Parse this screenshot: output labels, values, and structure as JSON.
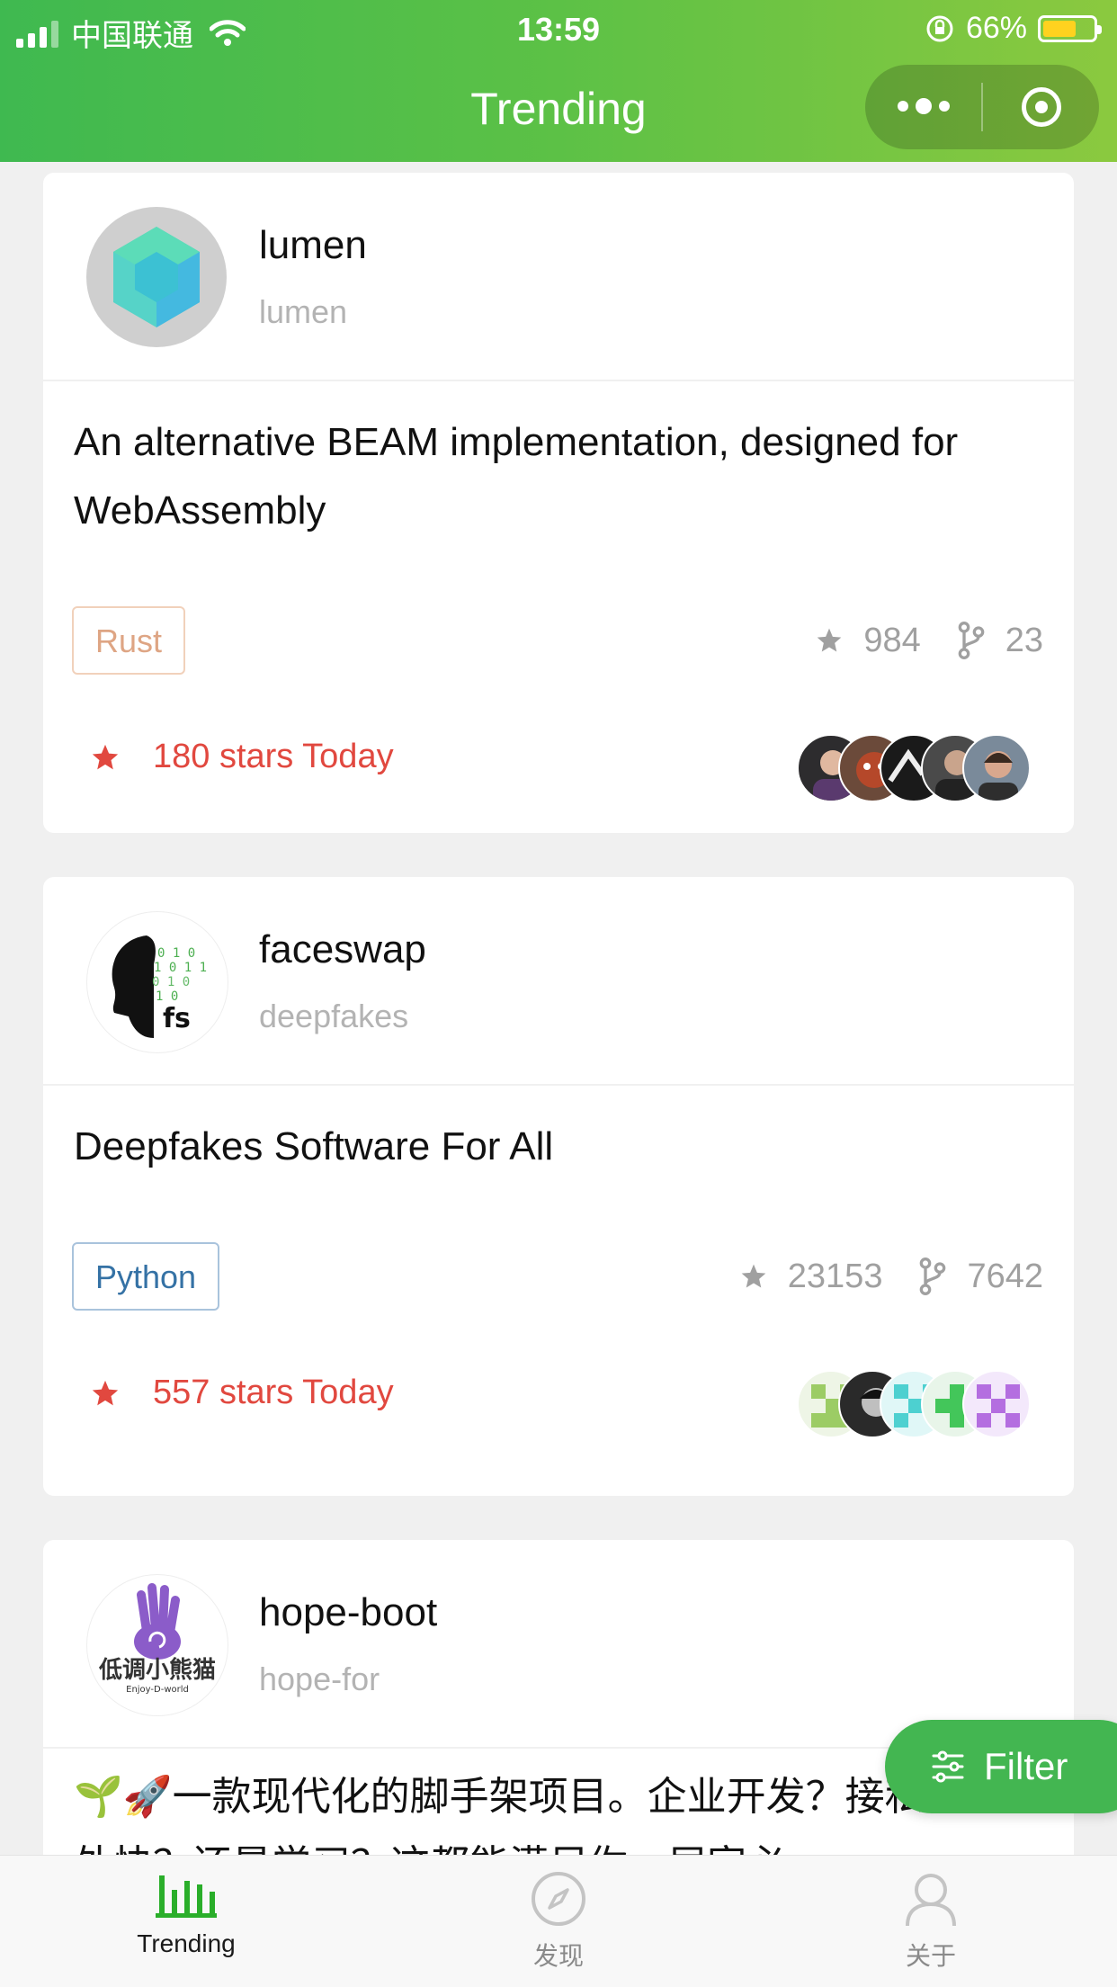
{
  "status_bar": {
    "carrier": "中国联通",
    "time": "13:59",
    "battery": "66%"
  },
  "nav": {
    "title": "Trending"
  },
  "repos": [
    {
      "name": "lumen",
      "owner": "lumen",
      "description": "An alternative BEAM implementation, designed for WebAssembly",
      "language": "Rust",
      "language_color": "#dea584",
      "stars": "984",
      "forks": "23",
      "stars_today": "180 stars Today"
    },
    {
      "name": "faceswap",
      "owner": "deepfakes",
      "description": "Deepfakes Software For All",
      "language": "Python",
      "language_color": "#3572A5",
      "stars": "23153",
      "forks": "7642",
      "stars_today": "557 stars Today"
    },
    {
      "name": "hope-boot",
      "owner": "hope-for",
      "description": "🌱🚀一款现代化的脚手架项目。企业开发？接私活？赚外快？还是学习？这都能满足你，居家必",
      "avatar_text": "低调小熊猫",
      "avatar_subtext": "Enjoy-D-world"
    }
  ],
  "fab": {
    "label": "Filter"
  },
  "tabbar": {
    "items": [
      {
        "label": "Trending"
      },
      {
        "label": "发现"
      },
      {
        "label": "关于"
      }
    ]
  },
  "colors": {
    "accent": "#43b651",
    "today": "#e1483f"
  }
}
